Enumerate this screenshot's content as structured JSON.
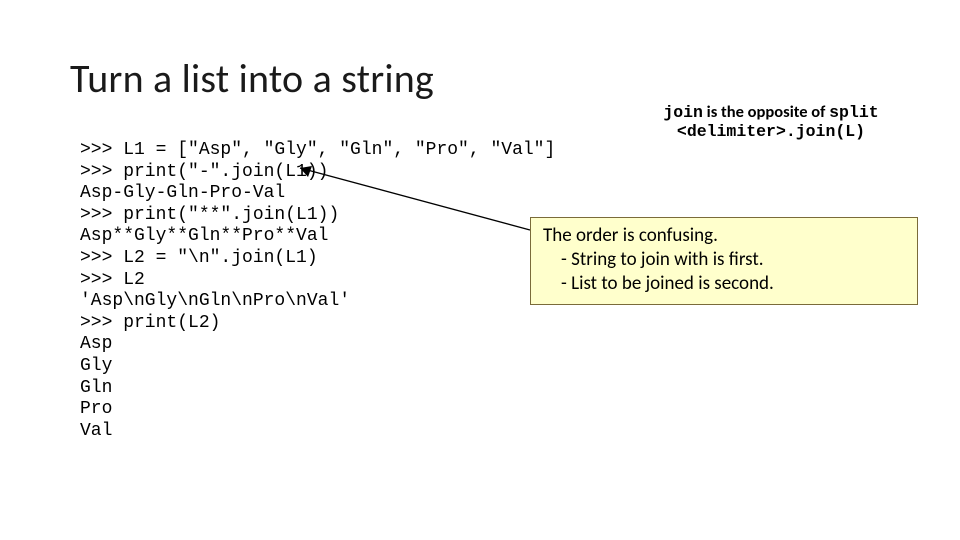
{
  "title": "Turn a list into a string",
  "code_lines": {
    "l0": ">>> L1 = [\"Asp\", \"Gly\", \"Gln\", \"Pro\", \"Val\"]",
    "l1": ">>> print(\"-\".join(L1))",
    "l2": "Asp-Gly-Gln-Pro-Val",
    "l3": ">>> print(\"**\".join(L1))",
    "l4": "Asp**Gly**Gln**Pro**Val",
    "l5": ">>> L2 = \"\\n\".join(L1)",
    "l6": ">>> L2",
    "l7": "'Asp\\nGly\\nGln\\nPro\\nVal'",
    "l8": ">>> print(L2)",
    "l9": "Asp",
    "l10": "Gly",
    "l11": "Gln",
    "l12": "Pro",
    "l13": "Val"
  },
  "top_note": {
    "join": "join",
    "mid": " is the opposite of ",
    "split": "split",
    "line2": "<delimiter>.join(L)"
  },
  "callout": {
    "line1": "The order is confusing.",
    "line2": "- String to join with is first.",
    "line3": "- List to be joined is second."
  }
}
